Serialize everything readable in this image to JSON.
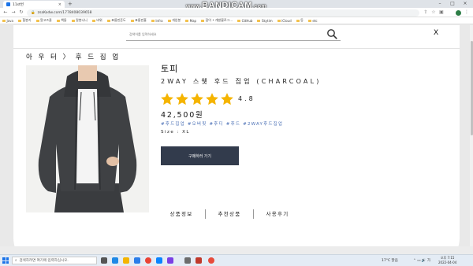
{
  "browser": {
    "tab_title": "11st번",
    "tab_close": "×",
    "new_tab": "+",
    "url": "zsaKodw.com/1778408039658",
    "window_controls": [
      "–",
      "□",
      "×"
    ],
    "bookmarks": [
      "Java",
      "힐봉키",
      "알고즈클",
      "책들",
      "칼봉니니",
      "바위",
      "표롬핀준도",
      "표롬핀흘",
      "Infra",
      "개업봉",
      "Map",
      "잡이 • 개발블로그...",
      "GitHub",
      "Skytim",
      "iCloud",
      "등",
      "etc"
    ]
  },
  "watermark": {
    "prefix": "www.",
    "brand": "BANDICAM",
    "suffix": ".com"
  },
  "page": {
    "search_placeholder": "검색어를 입력하세요",
    "close": "X",
    "breadcrumb": "아 우 터  〉 후 드 집 업",
    "product": {
      "title": "토피",
      "subtitle": "2WAY 스웻 후드 집업 (CHARCOAL)",
      "rating_value": 4.8,
      "rating_text": "4.8",
      "price": "42,500원",
      "tags": [
        "#후드집업",
        "#오버핏",
        "#후디",
        "#후드",
        "#2WAY후드집업"
      ],
      "size": "Size : XL",
      "buy_label": "구매하러 가기"
    },
    "detail_tabs": [
      "상품정보",
      "추천상품",
      "사용후기"
    ],
    "colors": {
      "star": "#f5b400",
      "button": "#323b4c",
      "tag": "#4a6fb5",
      "hoodie": "#3f4144"
    }
  },
  "taskbar": {
    "search_placeholder": "검색하려면 여기에 입력하십시오.",
    "weather": "17°C 맑음",
    "time": "오후 7:15",
    "date": "2022-04-04"
  }
}
